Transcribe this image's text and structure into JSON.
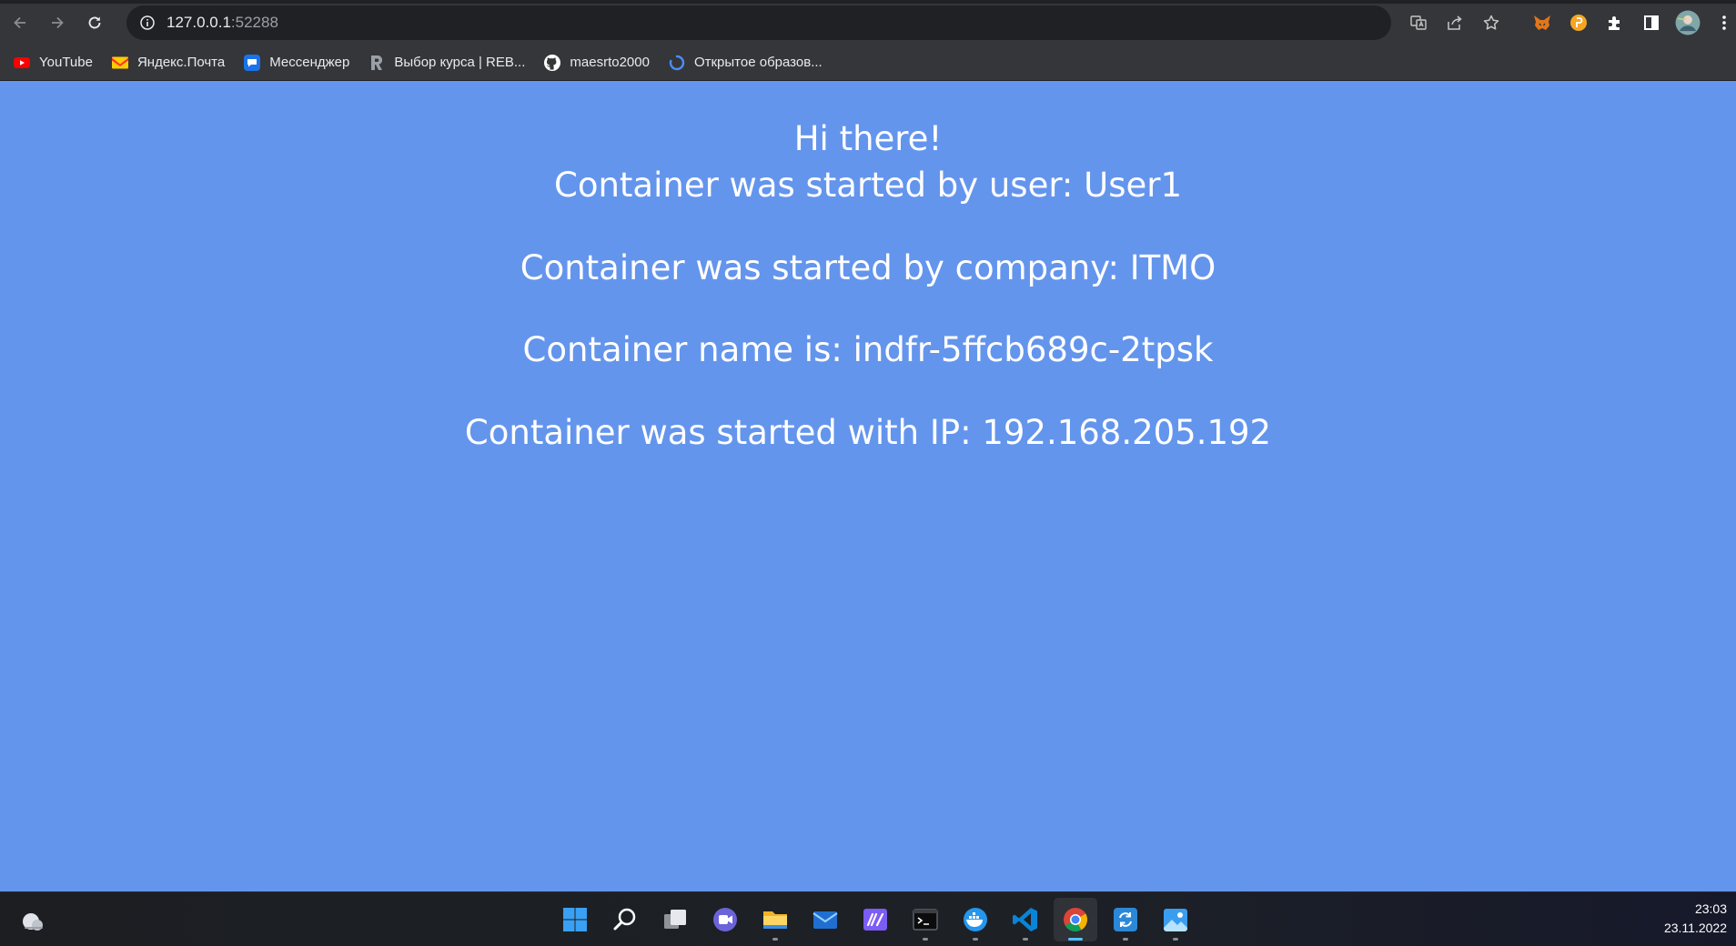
{
  "browser": {
    "url_host": "127.0.0.1",
    "url_port": ":52288"
  },
  "bookmarks": [
    {
      "label": "YouTube",
      "icon": "youtube-icon"
    },
    {
      "label": "Яндекс.Почта",
      "icon": "yandex-mail-icon"
    },
    {
      "label": "Мессенджер",
      "icon": "messenger-icon"
    },
    {
      "label": "Выбор курса | REB...",
      "icon": "course-r-icon"
    },
    {
      "label": "maesrto2000",
      "icon": "github-icon"
    },
    {
      "label": "Открытое образов...",
      "icon": "loading-spinner-icon"
    }
  ],
  "page": {
    "greeting": "Hi there!",
    "user_line": "Container was started by user: User1",
    "company_line": "Container was started by company: ITMO",
    "name_line": "Container name is: indfr-5ffcb689c-2tpsk",
    "ip_line": "Container was started with IP: 192.168.205.192"
  },
  "colors": {
    "page_background": "#6495ed",
    "page_text": "#ffffff"
  },
  "taskbar": {
    "time": "23:03",
    "date": "23.11.2022"
  }
}
